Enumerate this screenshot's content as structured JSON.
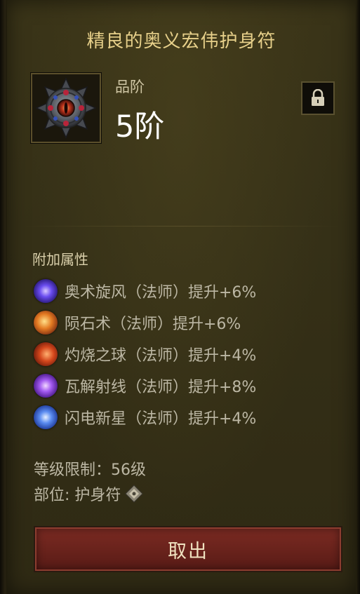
{
  "item": {
    "title": "精良的奥义宏伟护身符",
    "icon": "amulet-icon",
    "grade_label": "品阶",
    "grade_value": "5阶",
    "lock_icon": "lock-icon"
  },
  "attributes": {
    "section_title": "附加属性",
    "list": [
      {
        "text": "奥术旋风（法师）提升+6%",
        "icon": "arcane-vortex-icon",
        "color": "#5b4ed6"
      },
      {
        "text": "陨石术（法师）提升+6%",
        "icon": "meteor-icon",
        "color": "#d86a22"
      },
      {
        "text": "灼烧之球（法师）提升+4%",
        "icon": "fireball-icon",
        "color": "#d0481e"
      },
      {
        "text": "瓦解射线（法师）提升+8%",
        "icon": "disintegrate-icon",
        "color": "#8a4ad8"
      },
      {
        "text": "闪电新星（法师）提升+4%",
        "icon": "lightning-nova-icon",
        "color": "#3e6fe0"
      }
    ]
  },
  "meta": {
    "level_req": "等级限制：56级",
    "slot_label": "部位: 护身符",
    "slot_icon": "amulet-slot-icon"
  },
  "actions": {
    "take_out": "取出"
  },
  "colors": {
    "title": "#e7d08a",
    "button": "#6a231c"
  }
}
